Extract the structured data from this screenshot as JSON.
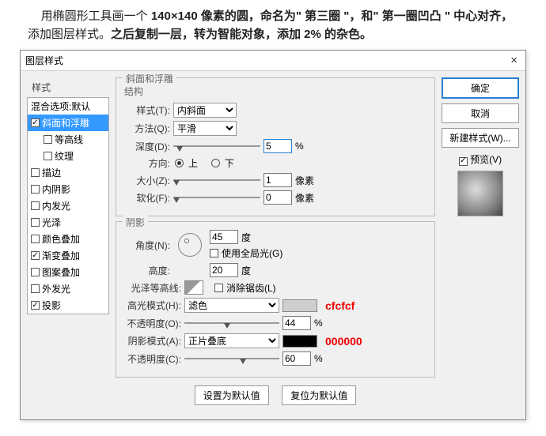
{
  "instruction": {
    "t1": "用椭圆形工具画一个 ",
    "b1": "140×140 像素的圆，命名为\" 第三圈 \"，和\" 第一圈凹凸 \" 中心对齐，",
    "t2": "添加图层样式。",
    "b2": "之后复制一层，转为智能对象，添加 2% 的杂色。"
  },
  "dialog": {
    "title": "图层样式"
  },
  "left": {
    "header": "样式",
    "blend": "混合选项:默认",
    "bevel": "斜面和浮雕",
    "contour": "等高线",
    "texture": "纹理",
    "stroke": "描边",
    "inner_shadow": "内阴影",
    "inner_glow": "内发光",
    "satin": "光泽",
    "color_overlay": "颜色叠加",
    "grad_overlay": "渐变叠加",
    "pat_overlay": "图案叠加",
    "outer_glow": "外发光",
    "drop_shadow": "投影"
  },
  "bevel": {
    "group": "斜面和浮雕",
    "struct": "结构",
    "style_l": "样式(T):",
    "style_v": "内斜面",
    "tech_l": "方法(Q):",
    "tech_v": "平滑",
    "depth_l": "深度(D):",
    "depth_v": "5",
    "pct": "%",
    "dir_l": "方向:",
    "up": "上",
    "down": "下",
    "size_l": "大小(Z):",
    "size_v": "1",
    "px": "像素",
    "soft_l": "软化(F):",
    "soft_v": "0"
  },
  "shade": {
    "group": "阴影",
    "angle_l": "角度(N):",
    "angle_v": "45",
    "deg": "度",
    "global": "使用全局光(G)",
    "alt_l": "高度:",
    "alt_v": "20",
    "gloss_l": "光泽等高线:",
    "anti": "消除锯齿(L)",
    "hi_l": "高光模式(H):",
    "hi_v": "滤色",
    "hi_annot": "cfcfcf",
    "hi_op_l": "不透明度(O):",
    "hi_op_v": "44",
    "sh_l": "阴影模式(A):",
    "sh_v": "正片叠底",
    "sh_annot": "000000",
    "sh_op_l": "不透明度(C):",
    "sh_op_v": "60"
  },
  "right": {
    "ok": "确定",
    "cancel": "取消",
    "newstyle": "新建样式(W)...",
    "preview": "预览(V)"
  },
  "bottom": {
    "default": "设置为默认值",
    "reset": "复位为默认值"
  }
}
